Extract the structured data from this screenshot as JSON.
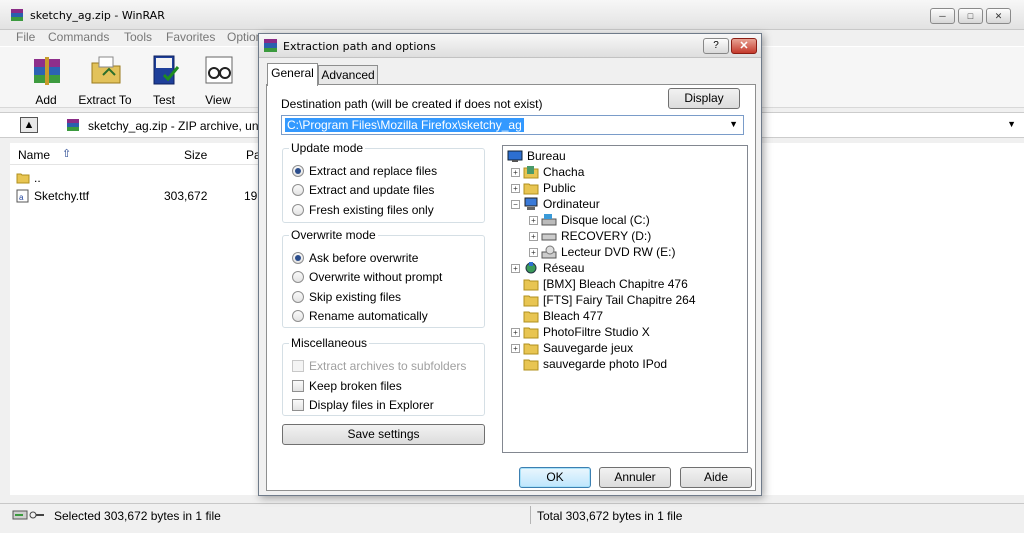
{
  "main_window": {
    "title": "sketchy_ag.zip - WinRAR",
    "menu": [
      "File",
      "Commands",
      "Tools",
      "Favorites",
      "Options"
    ],
    "toolbar": [
      "Add",
      "Extract To",
      "Test",
      "View"
    ],
    "address": "sketchy_ag.zip - ZIP archive, unp",
    "columns": {
      "name": "Name",
      "size": "Size",
      "packed": "Pa"
    },
    "files": [
      {
        "name": "..",
        "size": "",
        "packed": ""
      },
      {
        "name": "Sketchy.ttf",
        "size": "303,672",
        "packed": "19"
      }
    ],
    "status_left": "Selected 303,672 bytes in 1 file",
    "status_right": "Total 303,672 bytes in 1 file"
  },
  "dialog": {
    "title": "Extraction path and options",
    "help_label": "?",
    "close_label": "✕",
    "tabs": [
      "General",
      "Advanced"
    ],
    "dest_label": "Destination path (will be created if does not exist)",
    "display_button": "Display",
    "dest_path": "C:\\Program Files\\Mozilla Firefox\\sketchy_ag",
    "update_mode": {
      "title": "Update mode",
      "options": [
        "Extract and replace files",
        "Extract and update files",
        "Fresh existing files only"
      ],
      "selected": 0
    },
    "overwrite_mode": {
      "title": "Overwrite mode",
      "options": [
        "Ask before overwrite",
        "Overwrite without prompt",
        "Skip existing files",
        "Rename automatically"
      ],
      "selected": 0
    },
    "misc": {
      "title": "Miscellaneous",
      "options": [
        "Extract archives to subfolders",
        "Keep broken files",
        "Display files in Explorer"
      ]
    },
    "save_button": "Save settings",
    "tree": [
      "Bureau",
      "Chacha",
      "Public",
      "Ordinateur",
      "Disque local (C:)",
      "RECOVERY (D:)",
      "Lecteur DVD RW (E:)",
      "Réseau",
      "[BMX] Bleach Chapitre 476",
      "[FTS] Fairy Tail Chapitre 264",
      "Bleach 477",
      "PhotoFiltre Studio X",
      "Sauvegarde jeux",
      "sauvegarde photo IPod"
    ],
    "ok_button": "OK",
    "cancel_button": "Annuler",
    "help_button": "Aide"
  }
}
